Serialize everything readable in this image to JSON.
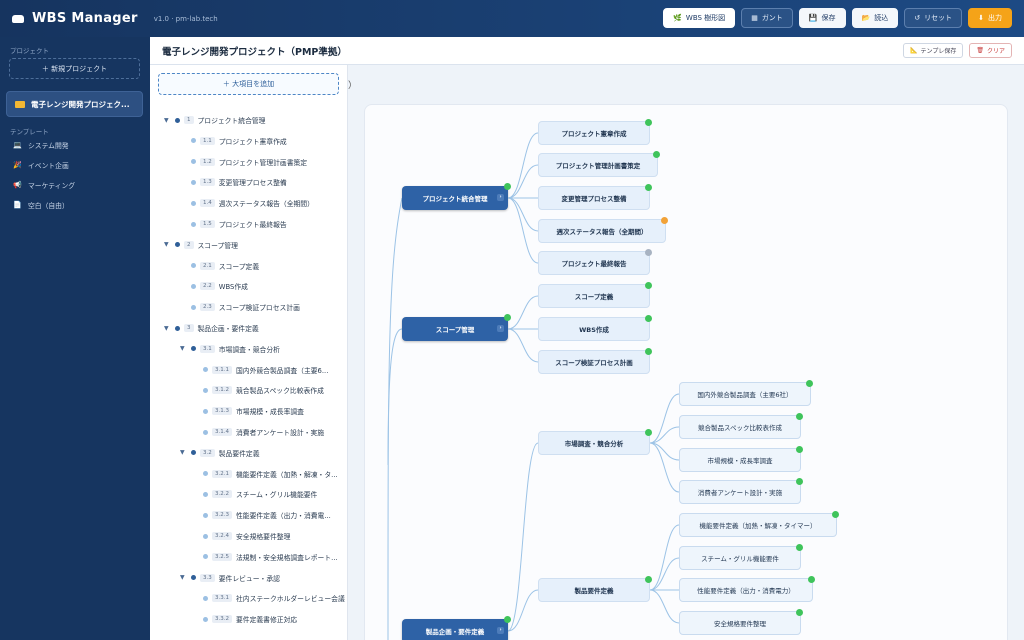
{
  "header": {
    "app_title": "WBS Manager",
    "version": "v1.0 · pm-lab.tech",
    "buttons": [
      {
        "label": "WBS 樹形図",
        "icon": "tree-icon",
        "active": true
      },
      {
        "label": "ガント",
        "icon": "gantt-icon"
      },
      {
        "label": "保存",
        "icon": "save-icon"
      },
      {
        "label": "読込",
        "icon": "folder-icon"
      },
      {
        "label": "リセット",
        "icon": "reset-icon"
      },
      {
        "label": "出力",
        "icon": "download-icon"
      }
    ]
  },
  "sidebar": {
    "projects_label": "プロジェクト",
    "new_project": "＋ 新規プロジェクト",
    "current_project": "電子レンジ開発プロジェク...",
    "templates_label": "テンプレート",
    "templates": [
      {
        "label": "システム開発",
        "icon": "laptop-icon"
      },
      {
        "label": "イベント企画",
        "icon": "party-icon"
      },
      {
        "label": "マーケティング",
        "icon": "megaphone-icon"
      },
      {
        "label": "空白（自由）",
        "icon": "document-icon"
      }
    ]
  },
  "main": {
    "title": "電子レンジ開発プロジェクト（PMP準拠）",
    "template_save": "テンプレ保存",
    "clear": "クリア",
    "crumb_fragment": "）"
  },
  "tree": {
    "add_root": "＋ 大項目を追加",
    "rows": [
      {
        "num": "1",
        "label": "プロジェクト統合管理",
        "depth": 0,
        "parent": true
      },
      {
        "num": "1.1",
        "label": "プロジェクト憲章作成",
        "depth": 1
      },
      {
        "num": "1.2",
        "label": "プロジェクト管理計画書策定",
        "depth": 1
      },
      {
        "num": "1.3",
        "label": "変更管理プロセス整備",
        "depth": 1
      },
      {
        "num": "1.4",
        "label": "週次ステータス報告（全期間）",
        "depth": 1
      },
      {
        "num": "1.5",
        "label": "プロジェクト最終報告",
        "depth": 1
      },
      {
        "num": "2",
        "label": "スコープ管理",
        "depth": 0,
        "parent": true
      },
      {
        "num": "2.1",
        "label": "スコープ定義",
        "depth": 1
      },
      {
        "num": "2.2",
        "label": "WBS作成",
        "depth": 1
      },
      {
        "num": "2.3",
        "label": "スコープ検証プロセス計画",
        "depth": 1
      },
      {
        "num": "3",
        "label": "製品企画・要件定義",
        "depth": 0,
        "parent": true
      },
      {
        "num": "3.1",
        "label": "市場調査・競合分析",
        "depth": 1,
        "parent": true
      },
      {
        "num": "3.1.1",
        "label": "国内外競合製品調査（主要6...",
        "depth": 2
      },
      {
        "num": "3.1.2",
        "label": "競合製品スペック比較表作成",
        "depth": 2
      },
      {
        "num": "3.1.3",
        "label": "市場規模・成長率調査",
        "depth": 2
      },
      {
        "num": "3.1.4",
        "label": "消費者アンケート設計・実施",
        "depth": 2
      },
      {
        "num": "3.2",
        "label": "製品要件定義",
        "depth": 1,
        "parent": true
      },
      {
        "num": "3.2.1",
        "label": "機能要件定義（加熱・解凍・タ...",
        "depth": 2
      },
      {
        "num": "3.2.2",
        "label": "スチーム・グリル機能要件",
        "depth": 2
      },
      {
        "num": "3.2.3",
        "label": "性能要件定義（出力・消費電...",
        "depth": 2
      },
      {
        "num": "3.2.4",
        "label": "安全規格要件整理",
        "depth": 2
      },
      {
        "num": "3.2.5",
        "label": "法規制・安全規格調査レポート...",
        "depth": 2
      },
      {
        "num": "3.3",
        "label": "要件レビュー・承認",
        "depth": 1,
        "parent": true
      },
      {
        "num": "3.3.1",
        "label": "社内ステークホルダーレビュー会議",
        "depth": 2
      },
      {
        "num": "3.3.2",
        "label": "要件定義書修正対応",
        "depth": 2
      }
    ]
  },
  "mindmap": {
    "nodes": [
      {
        "id": "n1",
        "label": "プロジェクト統合管理",
        "level": 1,
        "status": "green",
        "expand": true
      },
      {
        "id": "n11",
        "label": "プロジェクト憲章作成",
        "level": 2,
        "status": "green"
      },
      {
        "id": "n12",
        "label": "プロジェクト管理計画書策定",
        "level": 2,
        "status": "green"
      },
      {
        "id": "n13",
        "label": "変更管理プロセス整備",
        "level": 2,
        "status": "green"
      },
      {
        "id": "n14",
        "label": "週次ステータス報告（全期間）",
        "level": 2,
        "status": "orange"
      },
      {
        "id": "n15",
        "label": "プロジェクト最終報告",
        "level": 2,
        "status": "gray"
      },
      {
        "id": "n2",
        "label": "スコープ管理",
        "level": 1,
        "status": "green",
        "expand": true
      },
      {
        "id": "n21",
        "label": "スコープ定義",
        "level": 2,
        "status": "green"
      },
      {
        "id": "n22",
        "label": "WBS作成",
        "level": 2,
        "status": "green"
      },
      {
        "id": "n23",
        "label": "スコープ検証プロセス計画",
        "level": 2,
        "status": "green"
      },
      {
        "id": "n31",
        "label": "市場調査・競合分析",
        "level": 2,
        "status": "green"
      },
      {
        "id": "n311",
        "label": "国内外競合製品調査（主要6社）",
        "level": 3,
        "status": "green"
      },
      {
        "id": "n312",
        "label": "競合製品スペック比較表作成",
        "level": 3,
        "status": "green"
      },
      {
        "id": "n313",
        "label": "市場規模・成長率調査",
        "level": 3,
        "status": "green"
      },
      {
        "id": "n314",
        "label": "消費者アンケート設計・実施",
        "level": 3,
        "status": "green"
      },
      {
        "id": "n32",
        "label": "製品要件定義",
        "level": 2,
        "status": "green"
      },
      {
        "id": "n321",
        "label": "機能要件定義（加熱・解凍・タイマー）",
        "level": 3,
        "status": "green"
      },
      {
        "id": "n322",
        "label": "スチーム・グリル機能要件",
        "level": 3,
        "status": "green"
      },
      {
        "id": "n323",
        "label": "性能要件定義（出力・消費電力）",
        "level": 3,
        "status": "green"
      },
      {
        "id": "n324",
        "label": "安全規格要件整理",
        "level": 3,
        "status": "green"
      },
      {
        "id": "n3",
        "label": "製品企画・要件定義",
        "level": 1,
        "status": "green",
        "expand": true
      }
    ]
  },
  "colors": {
    "accent": "#2e62a6",
    "header": "#16345f",
    "sidebar": "#163560",
    "export": "#f5a318",
    "done": "#3fc45b",
    "in_progress": "#f2a237",
    "todo": "#a8b3c2"
  }
}
